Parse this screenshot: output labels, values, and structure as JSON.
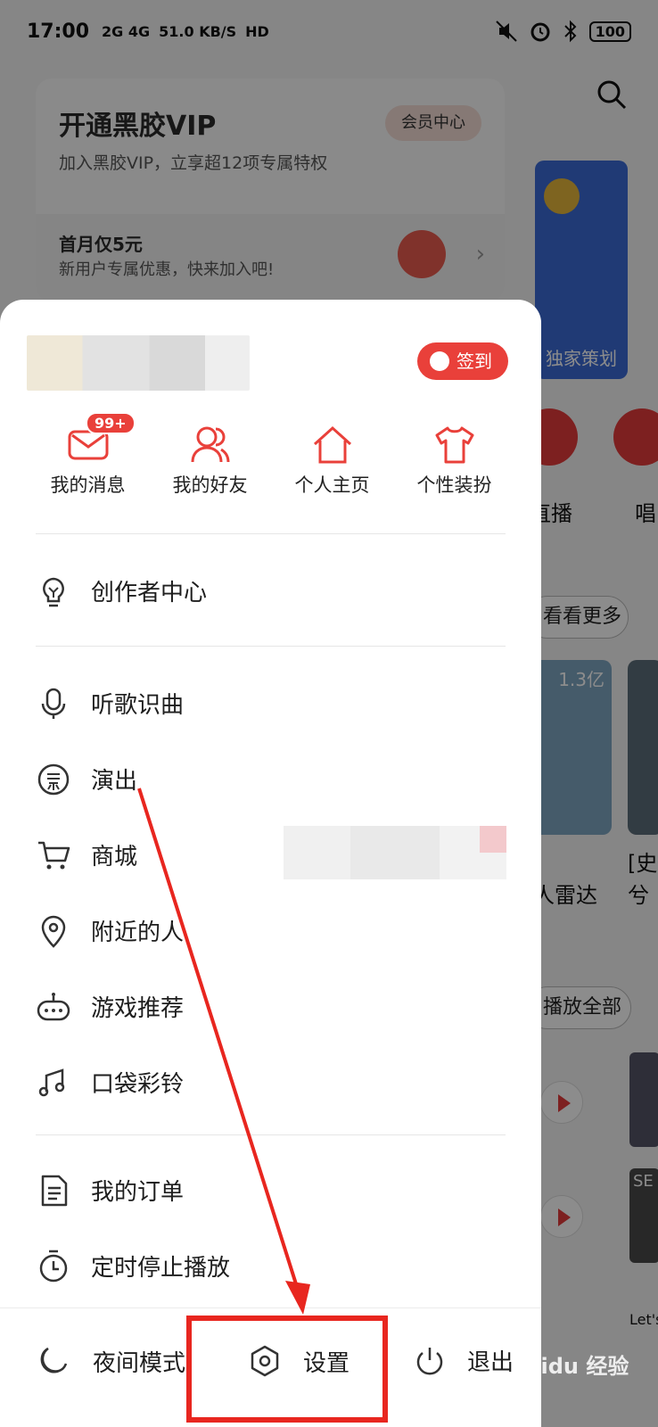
{
  "status_bar": {
    "time": "17:00",
    "network": "2G 4G",
    "speed": "51.0 KB/S",
    "hd": "HD",
    "battery": "100"
  },
  "vip": {
    "title": "开通黑胶VIP",
    "subtitle": "加入黑胶VIP，立享超12项专属特权",
    "center_button": "会员中心",
    "promo_title": "首月仅5元",
    "promo_subtitle": "新用户专属优惠，快来加入吧!"
  },
  "checkin_label": "签到",
  "quick_actions": [
    {
      "label": "我的消息",
      "icon": "mail-icon",
      "badge": "99+"
    },
    {
      "label": "我的好友",
      "icon": "friends-icon"
    },
    {
      "label": "个人主页",
      "icon": "home-icon"
    },
    {
      "label": "个性装扮",
      "icon": "shirt-icon"
    }
  ],
  "menu_group_1": [
    {
      "label": "创作者中心",
      "icon": "bulb-icon"
    }
  ],
  "menu_group_2": [
    {
      "label": "听歌识曲",
      "icon": "mic-icon"
    },
    {
      "label": "演出",
      "icon": "ticket-icon"
    },
    {
      "label": "商城",
      "icon": "cart-icon"
    },
    {
      "label": "附近的人",
      "icon": "location-icon"
    },
    {
      "label": "游戏推荐",
      "icon": "gamepad-icon"
    },
    {
      "label": "口袋彩铃",
      "icon": "ringtone-icon"
    }
  ],
  "menu_group_3": [
    {
      "label": "我的订单",
      "icon": "order-icon"
    },
    {
      "label": "定时停止播放",
      "icon": "timer-icon"
    }
  ],
  "bottom_bar": {
    "night_mode": "夜间模式",
    "settings": "设置",
    "exit": "退出"
  },
  "background": {
    "poster_label": "独家策划",
    "circle_label_1": "直播",
    "circle_label_2": "唱",
    "see_more": "看看更多",
    "play_count": "1.3亿",
    "card_text_1": "人雷达",
    "card_text_2": "[史",
    "card_text_3": "兮",
    "play_all": "播放全部",
    "thumb_text_1": "SE",
    "thumb_text_2": "Let's"
  },
  "watermark": "Baidu 经验",
  "colors": {
    "accent": "#e9403a",
    "annotation": "#e8261f"
  }
}
